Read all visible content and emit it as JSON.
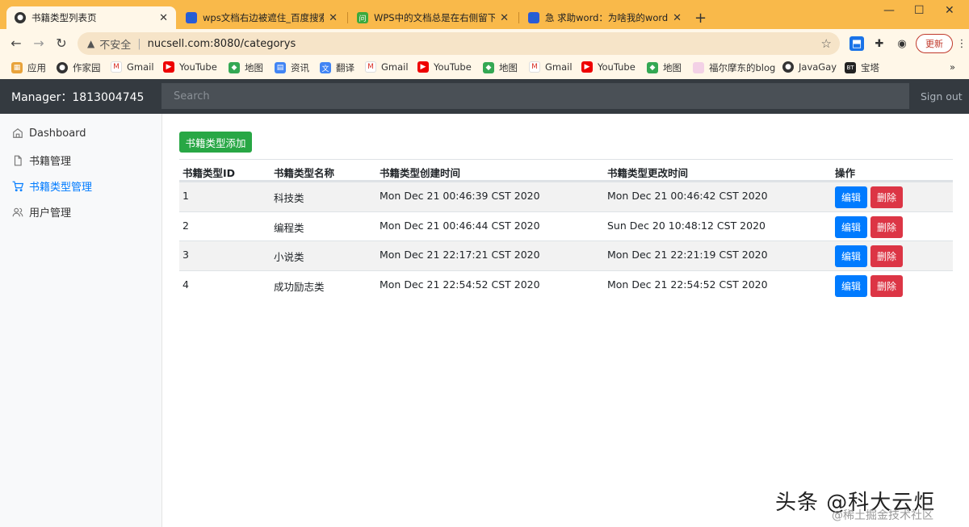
{
  "browser": {
    "tabs": [
      {
        "title": "书籍类型列表页",
        "favicon": "globe-icon"
      },
      {
        "title": "wps文档右边被遮住_百度搜索",
        "favicon": "baidu-paw-icon"
      },
      {
        "title": "WPS中的文档总是在右侧留下空白",
        "favicon": "wps-icon"
      },
      {
        "title": "急 求助word：为啥我的word打开",
        "favicon": "baidu-paw-icon"
      }
    ],
    "url": {
      "insecure_label": "不安全",
      "address": "nucsell.com:8080/categorys"
    },
    "update_label": "更新",
    "bookmarks": [
      "应用",
      "作家园",
      "Gmail",
      "YouTube",
      "地图",
      "资讯",
      "翻译",
      "Gmail",
      "YouTube",
      "地图",
      "Gmail",
      "YouTube",
      "地图",
      "福尔摩东的blog",
      "JavaGay",
      "宝塔"
    ],
    "more": "»"
  },
  "navbar": {
    "brand": "Manager：1813004745",
    "search_placeholder": "Search",
    "signout": "Sign out"
  },
  "sidebar": {
    "items": [
      {
        "label": "Dashboard",
        "icon": "home-icon"
      },
      {
        "label": "书籍管理",
        "icon": "file-icon"
      },
      {
        "label": "书籍类型管理",
        "icon": "cart-icon",
        "active": true
      },
      {
        "label": "用户管理",
        "icon": "users-icon"
      }
    ]
  },
  "main": {
    "add_button": "书籍类型添加",
    "table": {
      "headers": [
        "书籍类型ID",
        "书籍类型名称",
        "书籍类型创建时间",
        "书籍类型更改时间",
        "操作"
      ],
      "rows": [
        {
          "id": "1",
          "name": "科技类",
          "created": "Mon Dec 21 00:46:39 CST 2020",
          "updated": "Mon Dec 21 00:46:42 CST 2020"
        },
        {
          "id": "2",
          "name": "编程类",
          "created": "Mon Dec 21 00:46:44 CST 2020",
          "updated": "Sun Dec 20 10:48:12 CST 2020"
        },
        {
          "id": "3",
          "name": "小说类",
          "created": "Mon Dec 21 22:17:21 CST 2020",
          "updated": "Mon Dec 21 22:21:19 CST 2020"
        },
        {
          "id": "4",
          "name": "成功励志类",
          "created": "Mon Dec 21 22:54:52 CST 2020",
          "updated": "Mon Dec 21 22:54:52 CST 2020"
        }
      ],
      "edit_label": "编辑",
      "delete_label": "删除"
    }
  },
  "watermark": {
    "main": "头条 @科大云炬",
    "sub": "@稀土掘金技术社区"
  },
  "colors": {
    "tabbar": "#f9b94a",
    "navbar": "#343a40",
    "primary": "#007bff",
    "success": "#28a745",
    "danger": "#dc3545"
  }
}
